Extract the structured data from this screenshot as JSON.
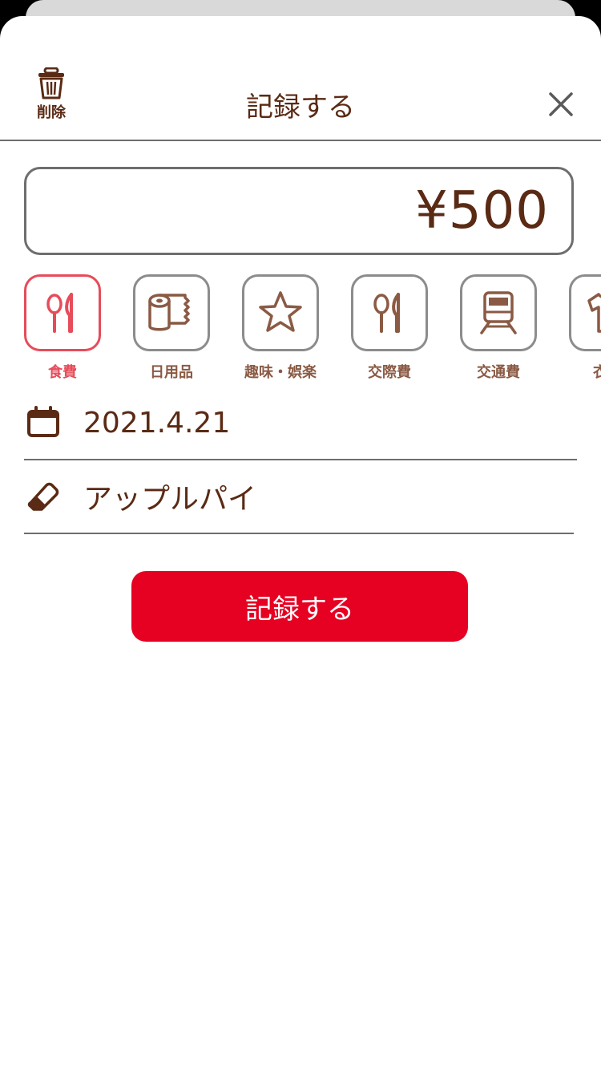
{
  "header": {
    "title": "記録する",
    "delete_label": "削除"
  },
  "amount": {
    "value": "¥500"
  },
  "categories": [
    {
      "label": "食費",
      "icon": "utensils-icon",
      "active": true
    },
    {
      "label": "日用品",
      "icon": "toilet-paper-icon",
      "active": false
    },
    {
      "label": "趣味・娯楽",
      "icon": "star-icon",
      "active": false
    },
    {
      "label": "交際費",
      "icon": "utensils-icon",
      "active": false
    },
    {
      "label": "交通費",
      "icon": "train-icon",
      "active": false
    },
    {
      "label": "衣服",
      "icon": "shirt-icon",
      "active": false
    }
  ],
  "date": {
    "value": "2021.4.21",
    "icon": "calendar-icon"
  },
  "memo": {
    "value": "アップルパイ",
    "icon": "eraser-icon"
  },
  "submit": {
    "label": "記録する"
  },
  "colors": {
    "brown": "#5a2a14",
    "accent_red": "#e60022",
    "active_pink": "#e64c5a",
    "border_gray": "#6e6e6e"
  }
}
